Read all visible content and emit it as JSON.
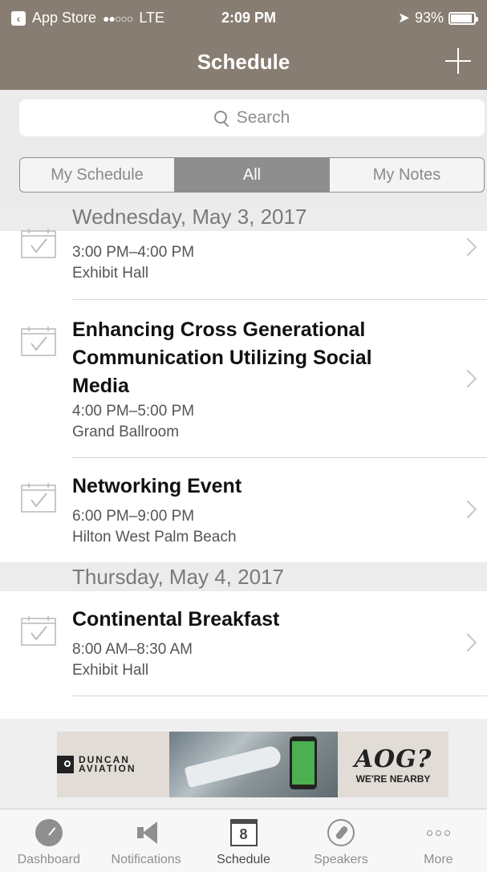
{
  "status_bar": {
    "back_app": "App Store",
    "signal": "●●○○○",
    "network": "LTE",
    "time": "2:09 PM",
    "battery": "93%",
    "battery_level": 0.93
  },
  "nav": {
    "title": "Schedule",
    "add_icon": "plus-icon"
  },
  "search": {
    "placeholder": "Search"
  },
  "segments": [
    {
      "label": "My Schedule",
      "active": false
    },
    {
      "label": "All",
      "active": true
    },
    {
      "label": "My Notes",
      "active": false
    }
  ],
  "sections": [
    {
      "header": "Wednesday, May 3, 2017",
      "items": [
        {
          "title": "",
          "time": "3:00 PM–4:00 PM",
          "location": "Exhibit Hall"
        },
        {
          "title": "Enhancing Cross Generational Communication Utilizing Social Media",
          "time": "4:00 PM–5:00 PM",
          "location": "Grand Ballroom"
        },
        {
          "title": "Networking Event",
          "time": "6:00 PM–9:00 PM",
          "location": "Hilton West Palm Beach"
        }
      ]
    },
    {
      "header": "Thursday, May 4, 2017",
      "items": [
        {
          "title": "Continental Breakfast",
          "time": "8:00 AM–8:30 AM",
          "location": "Exhibit Hall"
        }
      ]
    }
  ],
  "ad": {
    "brand": "DUNCAN AVIATION",
    "headline": "AOG?",
    "subline": "WE'RE NEARBY"
  },
  "tabs": [
    {
      "label": "Dashboard",
      "icon": "dashboard-gauge-icon"
    },
    {
      "label": "Notifications",
      "icon": "megaphone-icon"
    },
    {
      "label": "Schedule",
      "icon": "calendar-icon",
      "badge": "8",
      "active": true
    },
    {
      "label": "Speakers",
      "icon": "microphone-icon"
    },
    {
      "label": "More",
      "icon": "more-dots-icon"
    }
  ]
}
